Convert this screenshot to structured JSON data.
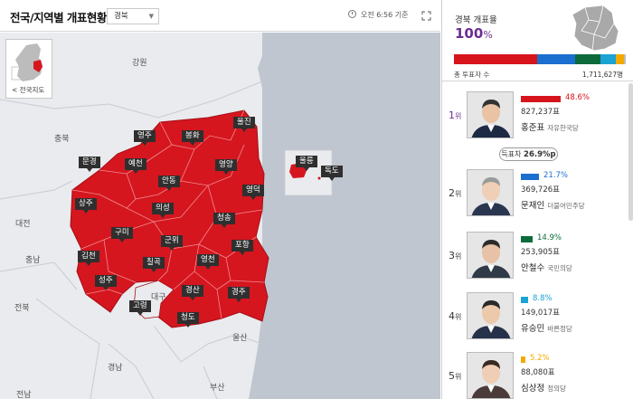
{
  "header": {
    "title": "전국/지역별 개표현황",
    "region_select": "경북",
    "time_label": "오전 6:56 기준"
  },
  "map": {
    "mini_map_label": "< 전국지도",
    "province_labels": {
      "gangwon": "강원",
      "chungbuk": "충북",
      "daejeon": "대전",
      "chungnam": "충남",
      "jeonbuk": "전북",
      "gyeongnam": "경남",
      "daegu": "대구",
      "ulsan": "울산",
      "busan": "부산",
      "jeonnam": "전남"
    },
    "counties": {
      "uljin": "울진",
      "yeongju": "영주",
      "bonghwa": "봉화",
      "mungyeong": "문경",
      "yecheon": "예천",
      "yeongyang": "영양",
      "andong": "안동",
      "yeongdeok": "영덕",
      "sangju": "상주",
      "uiseong": "의성",
      "cheongsong": "청송",
      "gumi": "구미",
      "gunwi": "군위",
      "pohang": "포항",
      "gimcheon": "김천",
      "chilgok": "칠곡",
      "yeongcheon": "영천",
      "seongju": "성주",
      "gyeongsan": "경산",
      "gyeongju": "경주",
      "goryeong": "고령",
      "cheongdo": "청도",
      "ulleung": "울릉",
      "dokdo": "독도"
    }
  },
  "summary": {
    "title": "경북 개표율",
    "rate_number": "100",
    "rate_unit": "%",
    "voters_label": "총 투표자 수",
    "voters_value": "1,711,627명"
  },
  "candidates": [
    {
      "rank": "1",
      "rank_unit": "위",
      "pct": "48.6%",
      "share": 48.6,
      "votes": "827,237표",
      "name": "홍준표",
      "party": "자유한국당",
      "color": "#d7141c"
    },
    {
      "rank": "2",
      "rank_unit": "위",
      "pct": "21.7%",
      "share": 21.7,
      "votes": "369,726표",
      "name": "문재인",
      "party": "더불어민주당",
      "color": "#1b6fcf"
    },
    {
      "rank": "3",
      "rank_unit": "위",
      "pct": "14.9%",
      "share": 14.9,
      "votes": "253,905표",
      "name": "안철수",
      "party": "국민의당",
      "color": "#0d6b3b"
    },
    {
      "rank": "4",
      "rank_unit": "위",
      "pct": "8.8%",
      "share": 8.8,
      "votes": "149,017표",
      "name": "유승민",
      "party": "바른정당",
      "color": "#1aa3d4"
    },
    {
      "rank": "5",
      "rank_unit": "위",
      "pct": "5.2%",
      "share": 5.2,
      "votes": "88,080표",
      "name": "심상정",
      "party": "정의당",
      "color": "#f3a900"
    }
  ],
  "gap": {
    "label": "득표차",
    "value": "26.9%p"
  }
}
